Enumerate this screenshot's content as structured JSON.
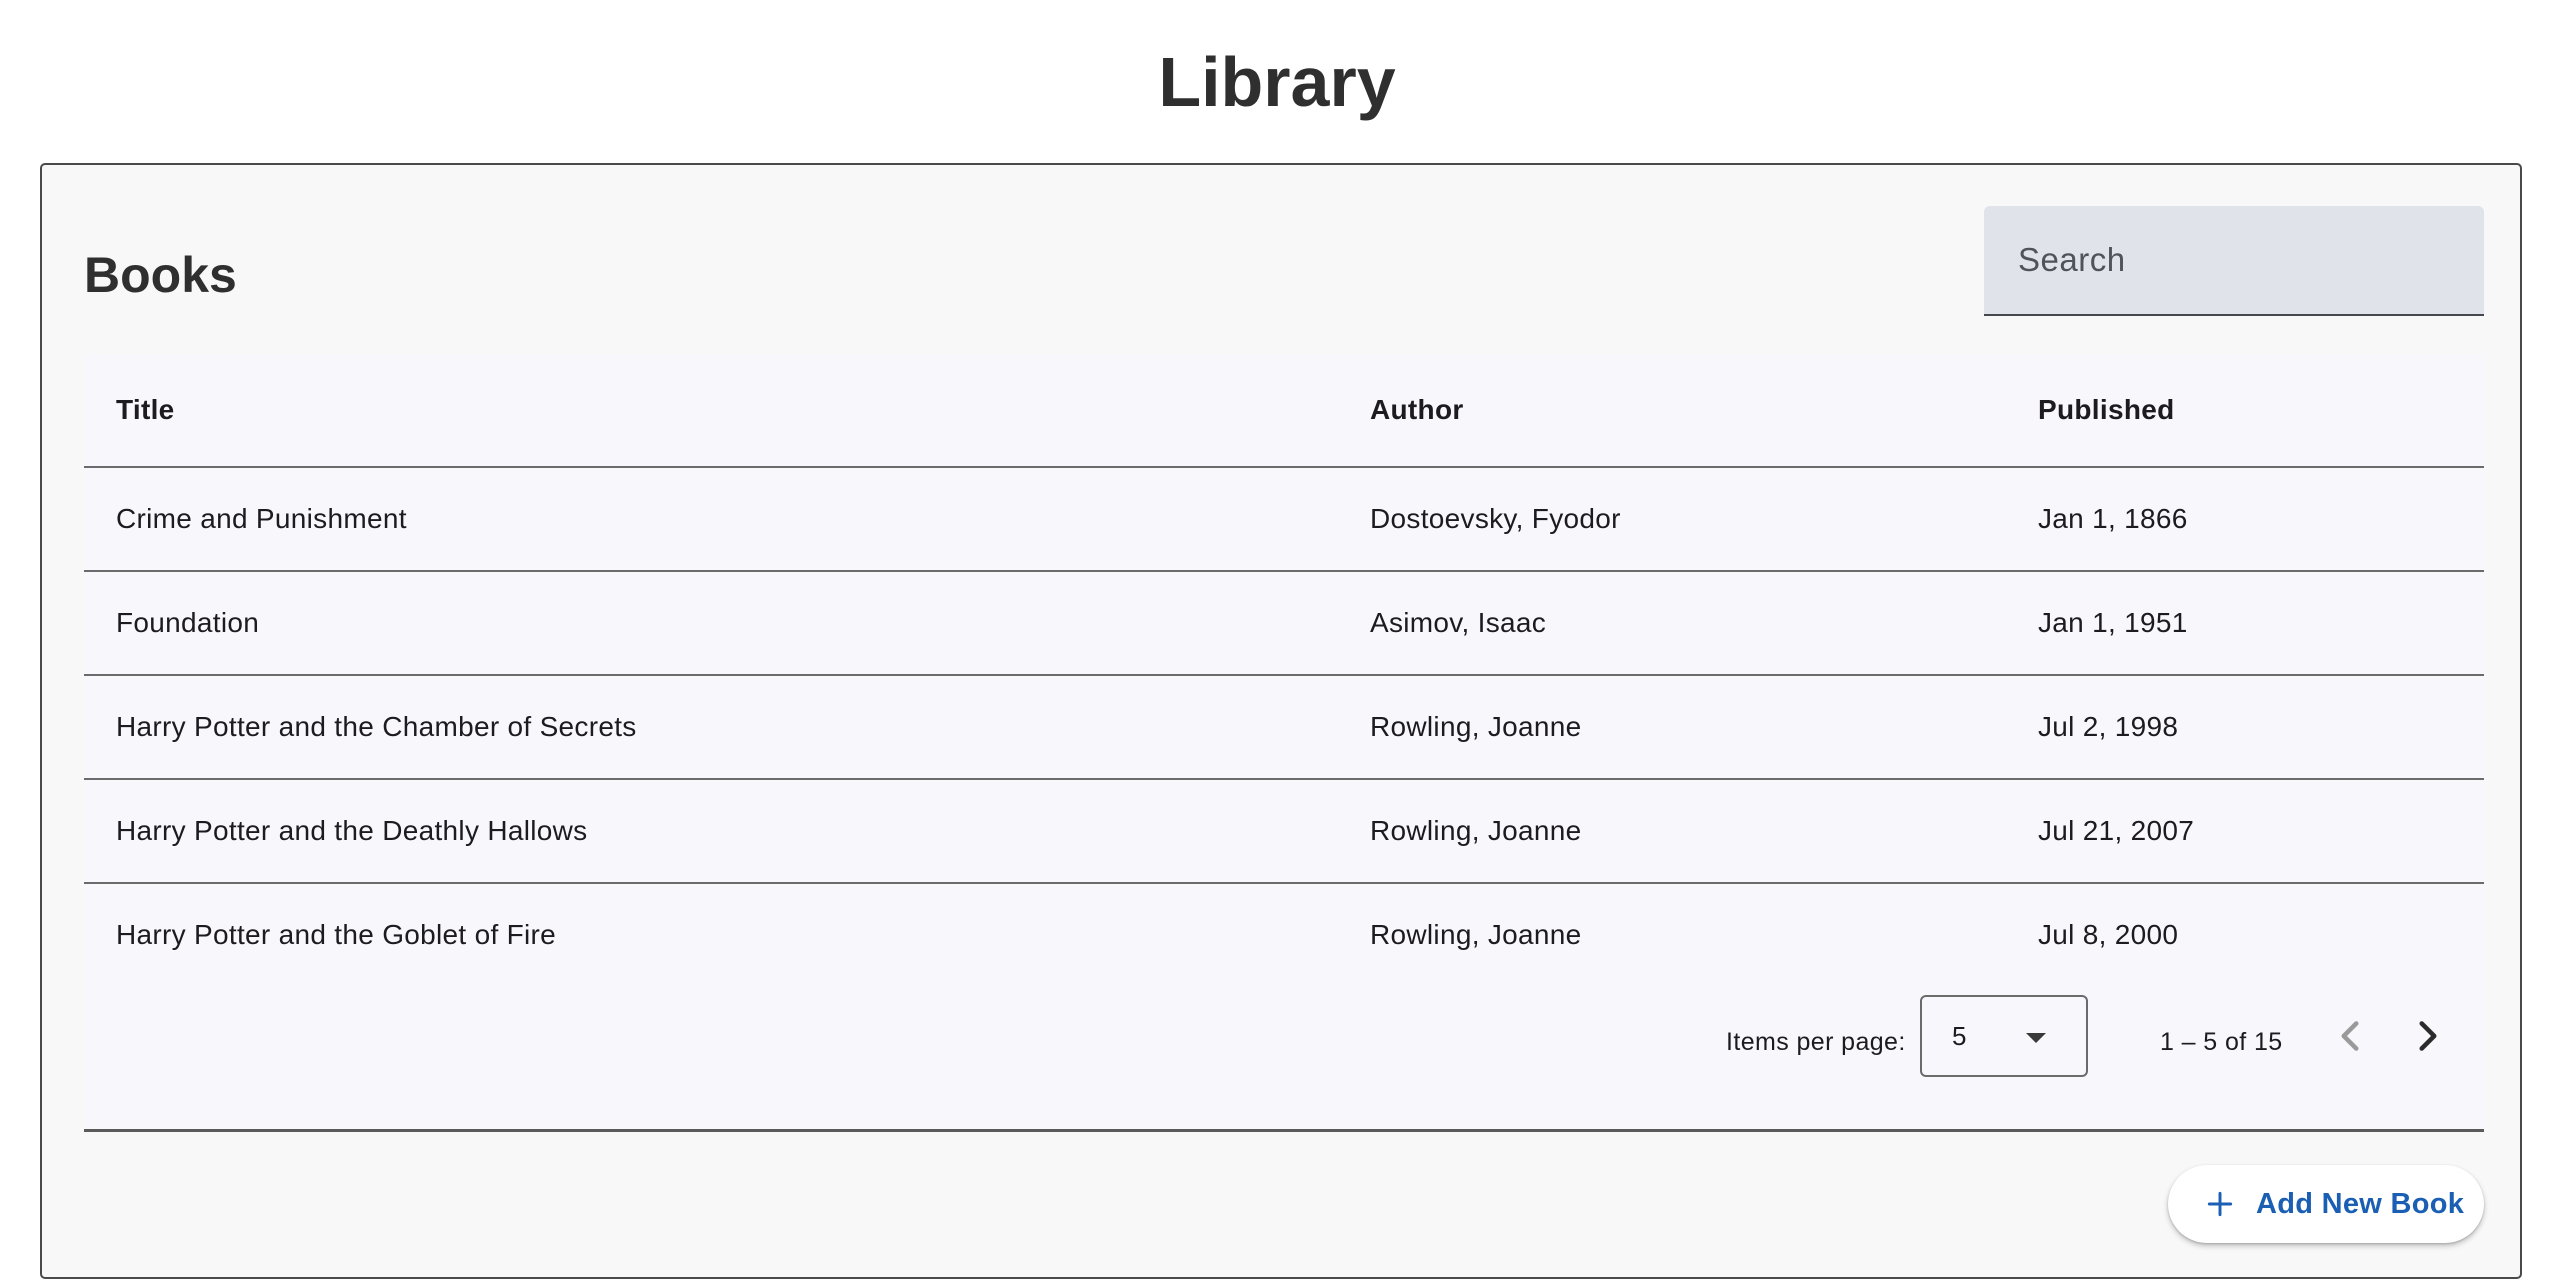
{
  "page": {
    "title": "Library"
  },
  "card": {
    "title": "Books",
    "search": {
      "placeholder": "Search",
      "value": ""
    }
  },
  "table": {
    "columns": [
      "Title",
      "Author",
      "Published"
    ],
    "rows": [
      {
        "title": "Crime and Punishment",
        "author": "Dostoevsky, Fyodor",
        "published": "Jan 1, 1866"
      },
      {
        "title": "Foundation",
        "author": "Asimov, Isaac",
        "published": "Jan 1, 1951"
      },
      {
        "title": "Harry Potter and the Chamber of Secrets",
        "author": "Rowling, Joanne",
        "published": "Jul 2, 1998"
      },
      {
        "title": "Harry Potter and the Deathly Hallows",
        "author": "Rowling, Joanne",
        "published": "Jul 21, 2007"
      },
      {
        "title": "Harry Potter and the Goblet of Fire",
        "author": "Rowling, Joanne",
        "published": "Jul 8, 2000"
      }
    ]
  },
  "paginator": {
    "items_per_page_label": "Items per page:",
    "items_per_page_value": "5",
    "range_label": "1 – 5 of 15",
    "prev_icon": "chevron-left-icon",
    "next_icon": "chevron-right-icon"
  },
  "actions": {
    "add_label": "Add New Book",
    "add_icon": "plus-icon"
  },
  "colors": {
    "accent": "#1a5fb4",
    "search_fill": "#e1e3ea",
    "card_bg": "#f8f8f8"
  }
}
